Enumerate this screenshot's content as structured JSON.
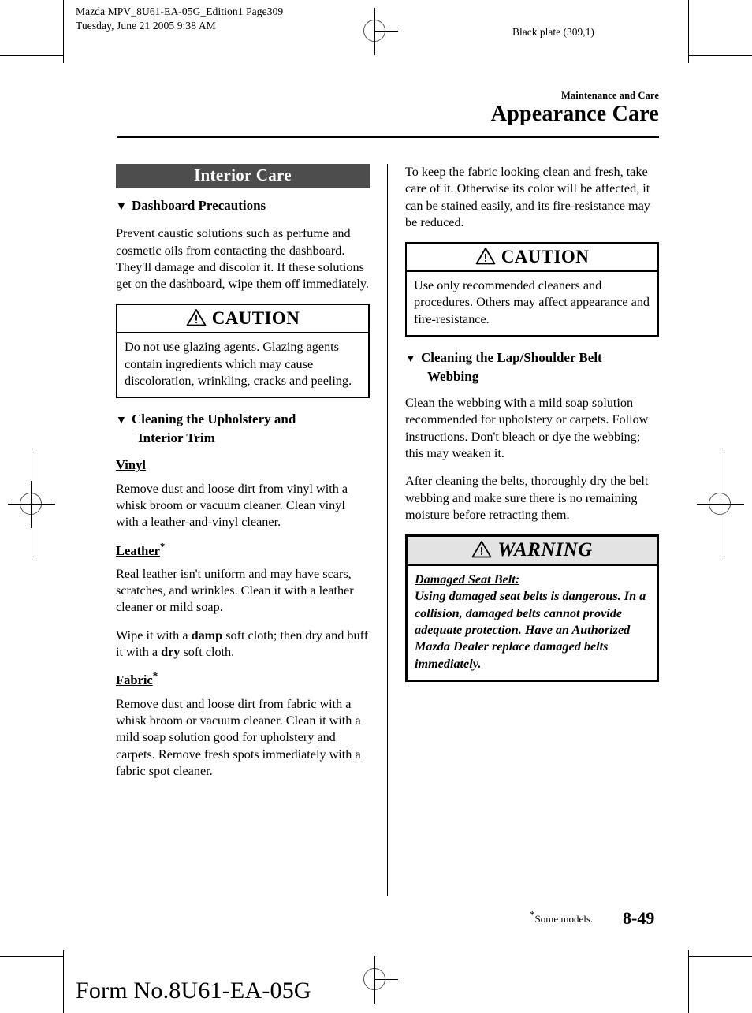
{
  "print_marks": {
    "slug": "Mazda MPV_8U61-EA-05G_Edition1 Page309\nTuesday, June 21 2005 9:38 AM",
    "plate": "Black plate (309,1)",
    "form_number": "Form No.8U61-EA-05G"
  },
  "header": {
    "kicker": "Maintenance and Care",
    "title": "Appearance Care"
  },
  "left_column": {
    "banner": "Interior Care",
    "dashboard_heading": {
      "triangle": "▼",
      "text": "Dashboard Precautions"
    },
    "dashboard_body": "Prevent caustic solutions such as perfume and cosmetic oils from contacting the dashboard. They'll damage and discolor it. If these solutions get on the dashboard, wipe them off immediately.",
    "caution": {
      "label": "CAUTION",
      "body": "Do not use glazing agents. Glazing agents contain ingredients which may cause discoloration, wrinkling, cracks and peeling."
    },
    "upholstery_heading": {
      "triangle": "▼",
      "line1": "Cleaning the Upholstery and",
      "line2": "Interior Trim"
    },
    "vinyl": {
      "heading": "Vinyl",
      "body": "Remove dust and loose dirt from vinyl with a whisk broom or vacuum cleaner. Clean vinyl with a leather-and-vinyl cleaner."
    },
    "leather": {
      "heading": "Leather",
      "star": "*",
      "body": "Real leather isn't uniform and may have scars, scratches, and wrinkles. Clean it with a leather cleaner or mild soap.",
      "body2_a": "Wipe it with a ",
      "body2_bold1": "damp",
      "body2_b": " soft cloth; then dry and buff it with a ",
      "body2_bold2": "dry",
      "body2_c": " soft cloth."
    },
    "fabric": {
      "heading": "Fabric",
      "star": "*",
      "body": "Remove dust and loose dirt from fabric with a whisk broom or vacuum cleaner. Clean it with a mild soap solution good for upholstery and carpets. Remove fresh spots immediately with a fabric spot cleaner."
    }
  },
  "right_column": {
    "fabric_care_body": "To keep the fabric looking clean and fresh, take care of it. Otherwise its color will be affected, it can be stained easily, and its fire-resistance may be reduced.",
    "caution": {
      "label": "CAUTION",
      "body": "Use only recommended cleaners and procedures. Others may affect appearance and fire-resistance."
    },
    "belt_heading": {
      "triangle": "▼",
      "line1": "Cleaning the Lap/Shoulder Belt",
      "line2": "Webbing"
    },
    "belt_body1": "Clean the webbing with a mild soap solution recommended for upholstery or carpets. Follow instructions. Don't bleach or dye the webbing; this may weaken it.",
    "belt_body2": "After cleaning the belts, thoroughly dry the belt webbing and make sure there is no remaining moisture before retracting them.",
    "warning": {
      "label": "WARNING",
      "title": "Damaged Seat Belt:",
      "body": "Using damaged seat belts is dangerous. In a collision, damaged belts cannot provide adequate protection. Have an Authorized Mazda Dealer replace damaged belts immediately."
    }
  },
  "footer": {
    "note_star": "*",
    "note": "Some models.",
    "page": "8-49"
  },
  "colors": {
    "banner_background": "#4d4d4d",
    "banner_text": "#ffffff",
    "warning_bar_background": "#e3e3e3",
    "rule": "#000000"
  }
}
